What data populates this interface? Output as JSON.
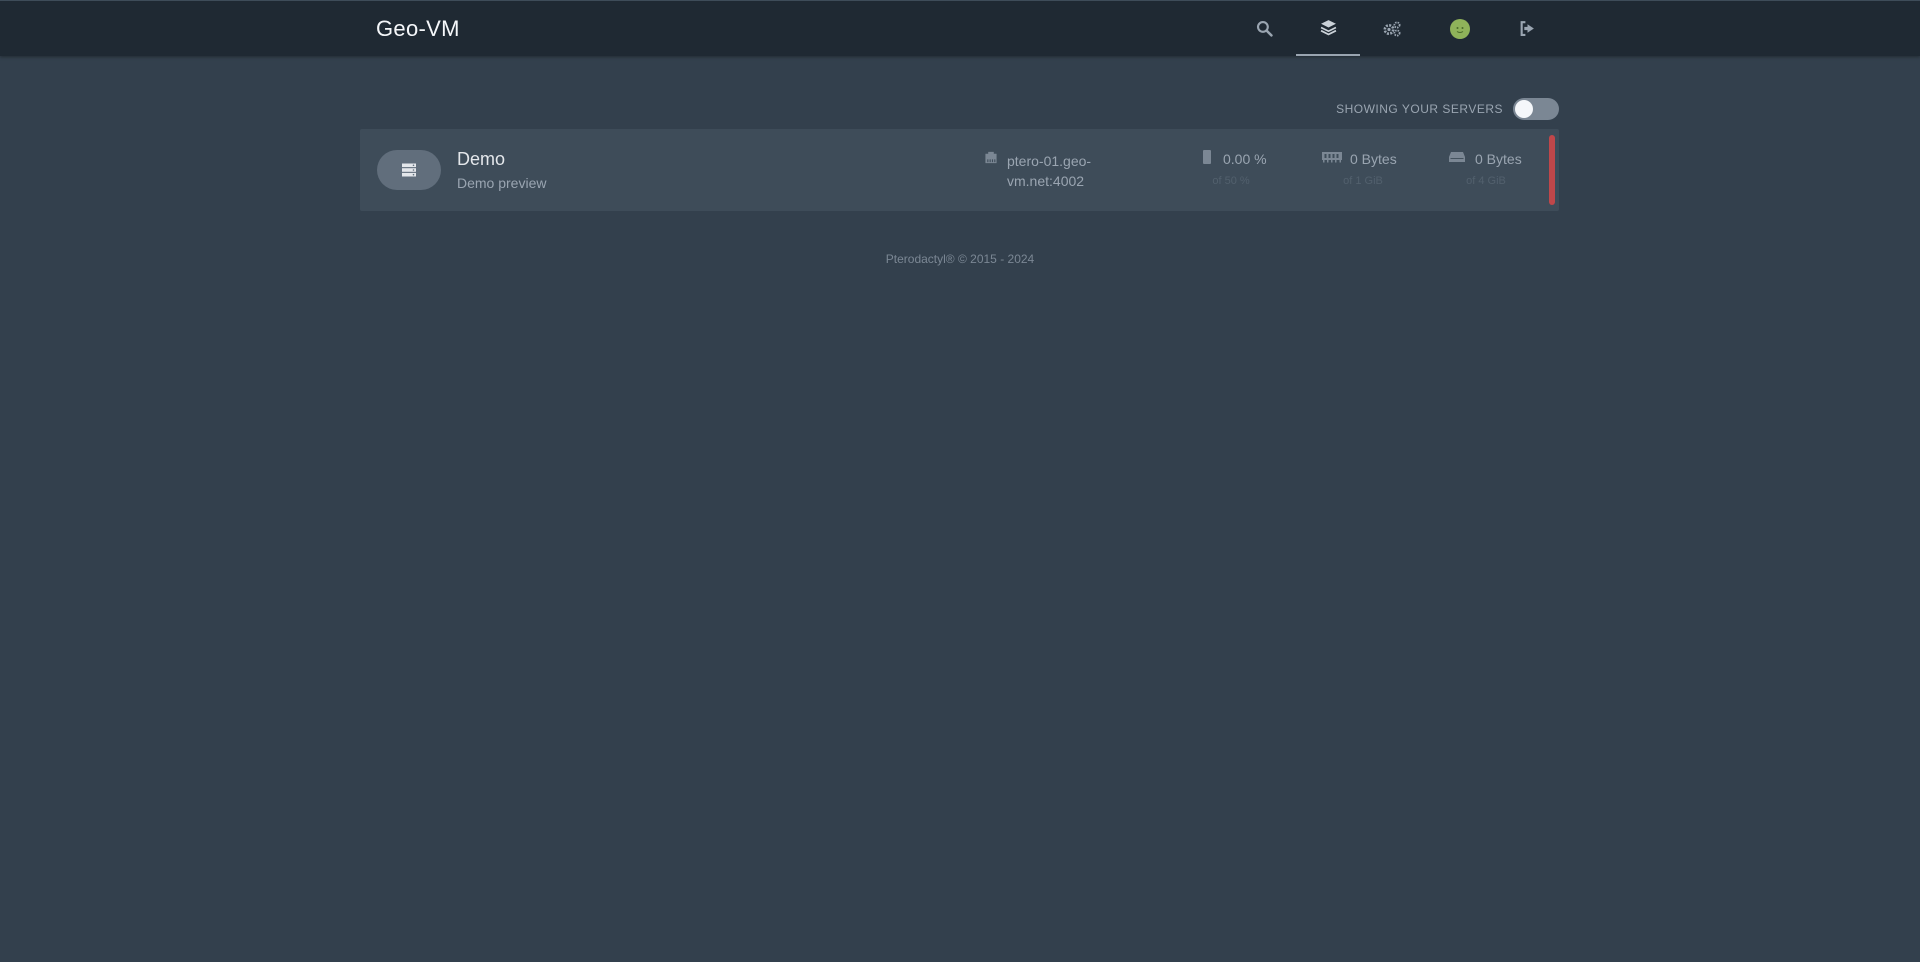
{
  "app": {
    "title": "Geo-VM"
  },
  "nav": {
    "icons": [
      "search-icon",
      "layers-icon",
      "cogs-icon",
      "user-avatar",
      "sign-out-icon"
    ],
    "active": "layers-icon"
  },
  "filter": {
    "label": "SHOWING YOUR SERVERS",
    "toggle_on": false
  },
  "servers": [
    {
      "name": "Demo",
      "description": "Demo preview",
      "address_line1": "ptero-01.geo-",
      "address_line2": "vm.net:4002",
      "cpu": {
        "value": "0.00 %",
        "limit": "of 50 %"
      },
      "memory": {
        "value": "0 Bytes",
        "limit": "of 1 GiB"
      },
      "disk": {
        "value": "0 Bytes",
        "limit": "of 4 GiB"
      },
      "status_color": "#c0474a"
    }
  ],
  "footer": {
    "text": "Pterodactyl® © 2015 - 2024"
  },
  "colors": {
    "background": "#33404d",
    "navbar": "#1f2933",
    "card": "#3e4c59",
    "status_offline": "#c0474a"
  }
}
